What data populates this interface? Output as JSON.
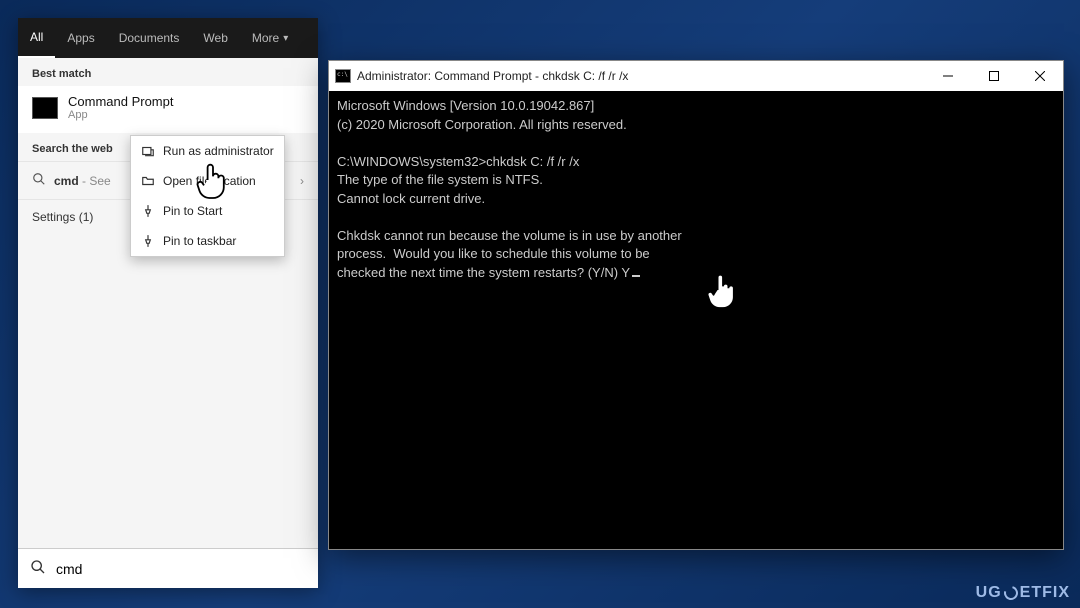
{
  "search": {
    "tabs": [
      "All",
      "Apps",
      "Documents",
      "Web",
      "More"
    ],
    "activeTab": 0,
    "bestMatchHeader": "Best match",
    "bestMatch": {
      "title": "Command Prompt",
      "sub": "App"
    },
    "webHeader": "Search the web",
    "webItem": {
      "query": "cmd",
      "suffix": " - See "
    },
    "settings": "Settings (1)",
    "input": "cmd"
  },
  "contextMenu": {
    "items": [
      {
        "label": "Run as administrator",
        "icon": "admin"
      },
      {
        "label": "Open file location",
        "icon": "folder"
      },
      {
        "label": "Pin to Start",
        "icon": "pin"
      },
      {
        "label": "Pin to taskbar",
        "icon": "pin"
      }
    ]
  },
  "cmd": {
    "title": "Administrator: Command Prompt - chkdsk  C: /f /r /x",
    "lines": [
      "Microsoft Windows [Version 10.0.19042.867]",
      "(c) 2020 Microsoft Corporation. All rights reserved.",
      "",
      "C:\\WINDOWS\\system32>chkdsk C: /f /r /x",
      "The type of the file system is NTFS.",
      "Cannot lock current drive.",
      "",
      "Chkdsk cannot run because the volume is in use by another",
      "process.  Would you like to schedule this volume to be",
      "checked the next time the system restarts? (Y/N) Y"
    ]
  },
  "watermark": "UGETFIX"
}
